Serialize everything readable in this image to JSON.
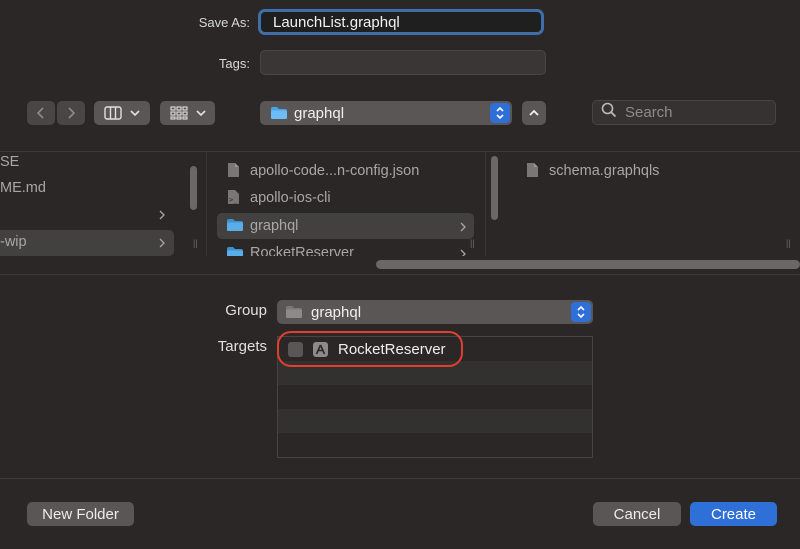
{
  "save_as": {
    "label": "Save As:",
    "value": "LaunchList.graphql"
  },
  "tags": {
    "label": "Tags:",
    "value": ""
  },
  "toolbar": {
    "location": "graphql",
    "search_placeholder": "Search"
  },
  "browser": {
    "col1": [
      {
        "label": "SE",
        "has_children": false,
        "selected": false
      },
      {
        "label": "ME.md",
        "has_children": false,
        "selected": false
      },
      {
        "label": "",
        "has_children": true,
        "selected": false
      },
      {
        "label": "-wip",
        "has_children": true,
        "selected": true
      }
    ],
    "col2": [
      {
        "label": "apollo-code...n-config.json",
        "type": "file",
        "has_children": false,
        "selected": false
      },
      {
        "label": "apollo-ios-cli",
        "type": "executable",
        "has_children": false,
        "selected": false
      },
      {
        "label": "graphql",
        "type": "folder",
        "has_children": true,
        "selected": true
      },
      {
        "label": "RocketReserver",
        "type": "folder",
        "has_children": true,
        "selected": false
      }
    ],
    "col3": [
      {
        "label": "schema.graphqls",
        "type": "file"
      }
    ]
  },
  "group": {
    "label": "Group",
    "value": "graphql"
  },
  "targets": {
    "label": "Targets",
    "items": [
      {
        "name": "RocketReserver",
        "checked": false
      }
    ]
  },
  "footer": {
    "new_folder": "New Folder",
    "cancel": "Cancel",
    "create": "Create"
  },
  "colors": {
    "accent": "#2f6fd8",
    "highlight_ring": "#e0402d",
    "background": "#2b2727"
  }
}
